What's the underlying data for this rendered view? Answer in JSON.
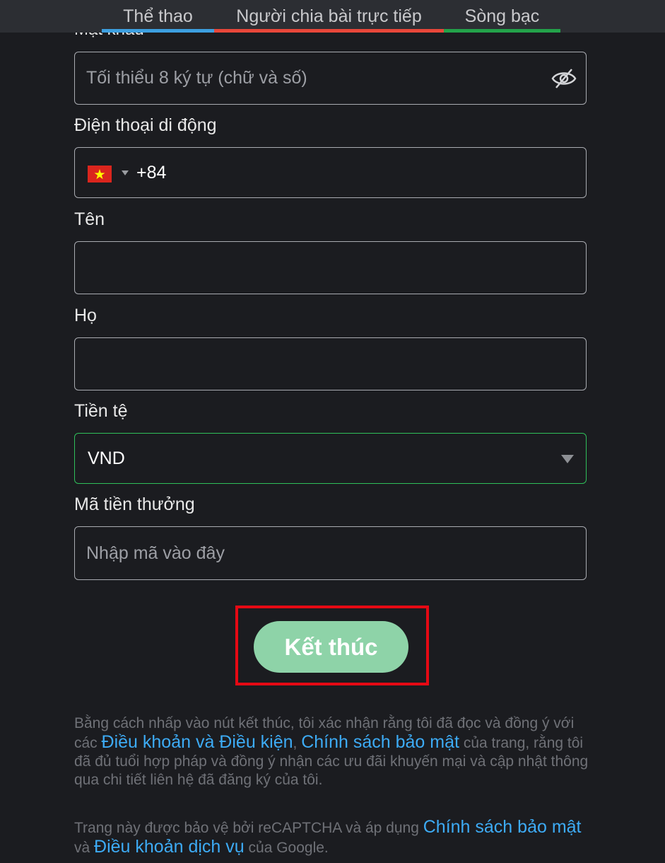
{
  "nav": {
    "tabs": [
      {
        "label": "Thể thao",
        "color": "#3d9fe0"
      },
      {
        "label": "Người chia bài trực tiếp",
        "color": "#e8473a"
      },
      {
        "label": "Sòng bạc",
        "color": "#23a24a"
      }
    ]
  },
  "form": {
    "password": {
      "label": "Mật khẩu",
      "placeholder": "Tối thiểu 8 ký tự (chữ và số)"
    },
    "phone": {
      "label": "Điện thoại di động",
      "country_code": "+84",
      "flag": "vietnam-flag"
    },
    "first_name": {
      "label": "Tên",
      "value": ""
    },
    "last_name": {
      "label": "Họ",
      "value": ""
    },
    "currency": {
      "label": "Tiền tệ",
      "selected": "VND",
      "border_color": "#2fbf5a"
    },
    "bonus_code": {
      "label": "Mã tiền thưởng",
      "placeholder": "Nhập mã vào đây"
    }
  },
  "submit": {
    "label": "Kết thúc",
    "button_color": "#8ed3a8",
    "highlight_color": "#e50914"
  },
  "legal": {
    "consent_part1": "Bằng cách nhấp vào nút kết thúc, tôi xác nhận rằng tôi đã đọc và đồng ý với các",
    "terms_link": "Điều khoản và Điều kiện",
    "comma": ",",
    "privacy_link": "Chính sách bảo mật",
    "consent_part2": "của trang, rằng tôi đã đủ tuổi hợp pháp và đồng ý nhận các ưu đãi khuyến mại và cập nhật thông qua chi tiết liên hệ đã đăng ký của tôi.",
    "recaptcha_part1": "Trang này được bảo vệ bởi reCAPTCHA và áp dụng",
    "google_privacy_link": "Chính sách bảo mật",
    "recaptcha_and": "và",
    "google_terms_link": "Điều khoản dịch vụ",
    "recaptcha_part2": "của Google."
  }
}
